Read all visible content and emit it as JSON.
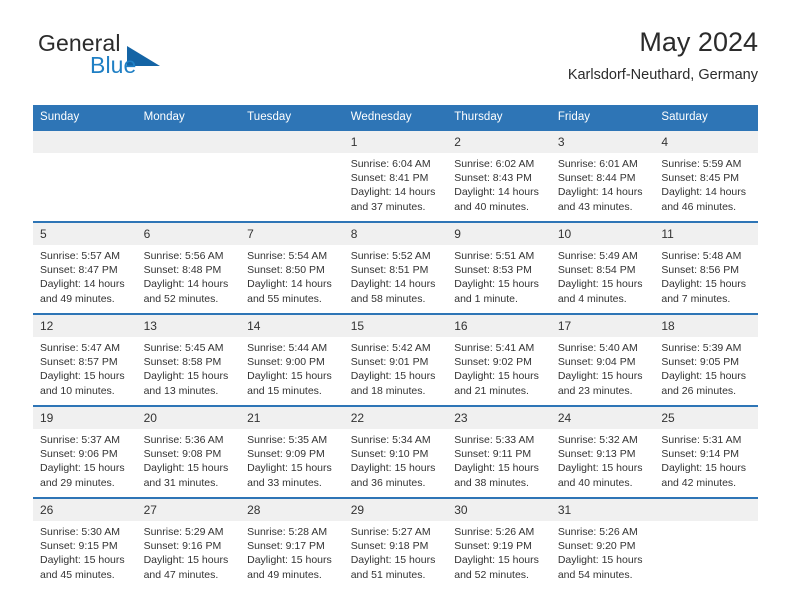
{
  "brand": {
    "word_one": "General",
    "word_two": "Blue",
    "triangle_icon": "triangle-icon"
  },
  "header": {
    "month_title": "May 2024",
    "location": "Karlsdorf-Neuthard, Germany"
  },
  "colors": {
    "header_blue": "#2e75b6",
    "brand_blue": "#1f7fc4",
    "daynum_band": "#f0f0f0",
    "text": "#333333"
  },
  "calendar": {
    "weekday_headers": [
      "Sunday",
      "Monday",
      "Tuesday",
      "Wednesday",
      "Thursday",
      "Friday",
      "Saturday"
    ],
    "weeks": [
      [
        {
          "day": "",
          "sunrise": "",
          "sunset": "",
          "daylight_1": "",
          "daylight_2": ""
        },
        {
          "day": "",
          "sunrise": "",
          "sunset": "",
          "daylight_1": "",
          "daylight_2": ""
        },
        {
          "day": "",
          "sunrise": "",
          "sunset": "",
          "daylight_1": "",
          "daylight_2": ""
        },
        {
          "day": "1",
          "sunrise": "Sunrise: 6:04 AM",
          "sunset": "Sunset: 8:41 PM",
          "daylight_1": "Daylight: 14 hours",
          "daylight_2": "and 37 minutes."
        },
        {
          "day": "2",
          "sunrise": "Sunrise: 6:02 AM",
          "sunset": "Sunset: 8:43 PM",
          "daylight_1": "Daylight: 14 hours",
          "daylight_2": "and 40 minutes."
        },
        {
          "day": "3",
          "sunrise": "Sunrise: 6:01 AM",
          "sunset": "Sunset: 8:44 PM",
          "daylight_1": "Daylight: 14 hours",
          "daylight_2": "and 43 minutes."
        },
        {
          "day": "4",
          "sunrise": "Sunrise: 5:59 AM",
          "sunset": "Sunset: 8:45 PM",
          "daylight_1": "Daylight: 14 hours",
          "daylight_2": "and 46 minutes."
        }
      ],
      [
        {
          "day": "5",
          "sunrise": "Sunrise: 5:57 AM",
          "sunset": "Sunset: 8:47 PM",
          "daylight_1": "Daylight: 14 hours",
          "daylight_2": "and 49 minutes."
        },
        {
          "day": "6",
          "sunrise": "Sunrise: 5:56 AM",
          "sunset": "Sunset: 8:48 PM",
          "daylight_1": "Daylight: 14 hours",
          "daylight_2": "and 52 minutes."
        },
        {
          "day": "7",
          "sunrise": "Sunrise: 5:54 AM",
          "sunset": "Sunset: 8:50 PM",
          "daylight_1": "Daylight: 14 hours",
          "daylight_2": "and 55 minutes."
        },
        {
          "day": "8",
          "sunrise": "Sunrise: 5:52 AM",
          "sunset": "Sunset: 8:51 PM",
          "daylight_1": "Daylight: 14 hours",
          "daylight_2": "and 58 minutes."
        },
        {
          "day": "9",
          "sunrise": "Sunrise: 5:51 AM",
          "sunset": "Sunset: 8:53 PM",
          "daylight_1": "Daylight: 15 hours",
          "daylight_2": "and 1 minute."
        },
        {
          "day": "10",
          "sunrise": "Sunrise: 5:49 AM",
          "sunset": "Sunset: 8:54 PM",
          "daylight_1": "Daylight: 15 hours",
          "daylight_2": "and 4 minutes."
        },
        {
          "day": "11",
          "sunrise": "Sunrise: 5:48 AM",
          "sunset": "Sunset: 8:56 PM",
          "daylight_1": "Daylight: 15 hours",
          "daylight_2": "and 7 minutes."
        }
      ],
      [
        {
          "day": "12",
          "sunrise": "Sunrise: 5:47 AM",
          "sunset": "Sunset: 8:57 PM",
          "daylight_1": "Daylight: 15 hours",
          "daylight_2": "and 10 minutes."
        },
        {
          "day": "13",
          "sunrise": "Sunrise: 5:45 AM",
          "sunset": "Sunset: 8:58 PM",
          "daylight_1": "Daylight: 15 hours",
          "daylight_2": "and 13 minutes."
        },
        {
          "day": "14",
          "sunrise": "Sunrise: 5:44 AM",
          "sunset": "Sunset: 9:00 PM",
          "daylight_1": "Daylight: 15 hours",
          "daylight_2": "and 15 minutes."
        },
        {
          "day": "15",
          "sunrise": "Sunrise: 5:42 AM",
          "sunset": "Sunset: 9:01 PM",
          "daylight_1": "Daylight: 15 hours",
          "daylight_2": "and 18 minutes."
        },
        {
          "day": "16",
          "sunrise": "Sunrise: 5:41 AM",
          "sunset": "Sunset: 9:02 PM",
          "daylight_1": "Daylight: 15 hours",
          "daylight_2": "and 21 minutes."
        },
        {
          "day": "17",
          "sunrise": "Sunrise: 5:40 AM",
          "sunset": "Sunset: 9:04 PM",
          "daylight_1": "Daylight: 15 hours",
          "daylight_2": "and 23 minutes."
        },
        {
          "day": "18",
          "sunrise": "Sunrise: 5:39 AM",
          "sunset": "Sunset: 9:05 PM",
          "daylight_1": "Daylight: 15 hours",
          "daylight_2": "and 26 minutes."
        }
      ],
      [
        {
          "day": "19",
          "sunrise": "Sunrise: 5:37 AM",
          "sunset": "Sunset: 9:06 PM",
          "daylight_1": "Daylight: 15 hours",
          "daylight_2": "and 29 minutes."
        },
        {
          "day": "20",
          "sunrise": "Sunrise: 5:36 AM",
          "sunset": "Sunset: 9:08 PM",
          "daylight_1": "Daylight: 15 hours",
          "daylight_2": "and 31 minutes."
        },
        {
          "day": "21",
          "sunrise": "Sunrise: 5:35 AM",
          "sunset": "Sunset: 9:09 PM",
          "daylight_1": "Daylight: 15 hours",
          "daylight_2": "and 33 minutes."
        },
        {
          "day": "22",
          "sunrise": "Sunrise: 5:34 AM",
          "sunset": "Sunset: 9:10 PM",
          "daylight_1": "Daylight: 15 hours",
          "daylight_2": "and 36 minutes."
        },
        {
          "day": "23",
          "sunrise": "Sunrise: 5:33 AM",
          "sunset": "Sunset: 9:11 PM",
          "daylight_1": "Daylight: 15 hours",
          "daylight_2": "and 38 minutes."
        },
        {
          "day": "24",
          "sunrise": "Sunrise: 5:32 AM",
          "sunset": "Sunset: 9:13 PM",
          "daylight_1": "Daylight: 15 hours",
          "daylight_2": "and 40 minutes."
        },
        {
          "day": "25",
          "sunrise": "Sunrise: 5:31 AM",
          "sunset": "Sunset: 9:14 PM",
          "daylight_1": "Daylight: 15 hours",
          "daylight_2": "and 42 minutes."
        }
      ],
      [
        {
          "day": "26",
          "sunrise": "Sunrise: 5:30 AM",
          "sunset": "Sunset: 9:15 PM",
          "daylight_1": "Daylight: 15 hours",
          "daylight_2": "and 45 minutes."
        },
        {
          "day": "27",
          "sunrise": "Sunrise: 5:29 AM",
          "sunset": "Sunset: 9:16 PM",
          "daylight_1": "Daylight: 15 hours",
          "daylight_2": "and 47 minutes."
        },
        {
          "day": "28",
          "sunrise": "Sunrise: 5:28 AM",
          "sunset": "Sunset: 9:17 PM",
          "daylight_1": "Daylight: 15 hours",
          "daylight_2": "and 49 minutes."
        },
        {
          "day": "29",
          "sunrise": "Sunrise: 5:27 AM",
          "sunset": "Sunset: 9:18 PM",
          "daylight_1": "Daylight: 15 hours",
          "daylight_2": "and 51 minutes."
        },
        {
          "day": "30",
          "sunrise": "Sunrise: 5:26 AM",
          "sunset": "Sunset: 9:19 PM",
          "daylight_1": "Daylight: 15 hours",
          "daylight_2": "and 52 minutes."
        },
        {
          "day": "31",
          "sunrise": "Sunrise: 5:26 AM",
          "sunset": "Sunset: 9:20 PM",
          "daylight_1": "Daylight: 15 hours",
          "daylight_2": "and 54 minutes."
        },
        {
          "day": "",
          "sunrise": "",
          "sunset": "",
          "daylight_1": "",
          "daylight_2": ""
        }
      ]
    ]
  }
}
